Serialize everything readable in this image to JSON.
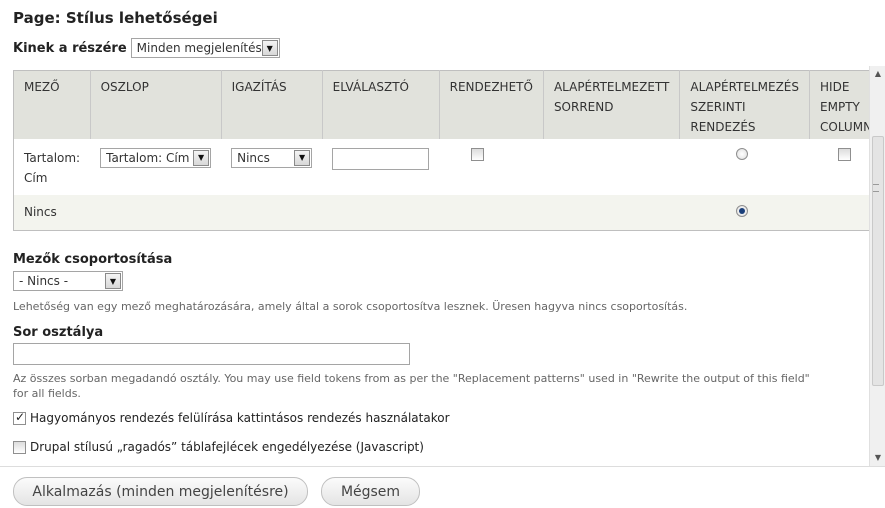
{
  "page": {
    "title": "Page: Stílus lehetőségei",
    "for_label": "Kinek a részére",
    "for_value": "Minden megjelenítés"
  },
  "table": {
    "headers": [
      "MEZŐ",
      "OSZLOP",
      "IGAZÍTÁS",
      "ELVÁLASZTÓ",
      "RENDEZHETŐ",
      "ALAPÉRTELMEZETT SORREND",
      "ALAPÉRTELMEZÉS SZERINTI RENDEZÉS",
      "HIDE EMPTY COLUMN"
    ],
    "rows": [
      {
        "field": "Tartalom: Cím",
        "column": "Tartalom: Cím",
        "align": "Nincs",
        "separator": "",
        "sortable": false,
        "default_sort": false,
        "hide_empty": false
      },
      {
        "field": "Nincs",
        "default_sort": true
      }
    ]
  },
  "grouping": {
    "heading": "Mezők csoportosítása",
    "value": "- Nincs -",
    "description": "Lehetőség van egy mező meghatározására, amely által a sorok csoportosítva lesznek. Üresen hagyva nincs csoportosítás."
  },
  "row_class": {
    "heading": "Sor osztálya",
    "value": "",
    "description_line1": "Az összes sorban megadandó osztály. You may use field tokens from as per the \"Replacement patterns\" used in \"Rewrite the output of this field\"",
    "description_line2": "for all fields."
  },
  "options": [
    {
      "label": "Hagyományos rendezés felülírása kattintásos rendezés használatakor",
      "checked": true
    },
    {
      "label": "Drupal stílusú „ragadós” táblafejlécek engedélyezése (Javascript)",
      "checked": false
    }
  ],
  "buttons": {
    "apply": "Alkalmazás (minden megjelenítésre)",
    "cancel": "Mégsem"
  }
}
